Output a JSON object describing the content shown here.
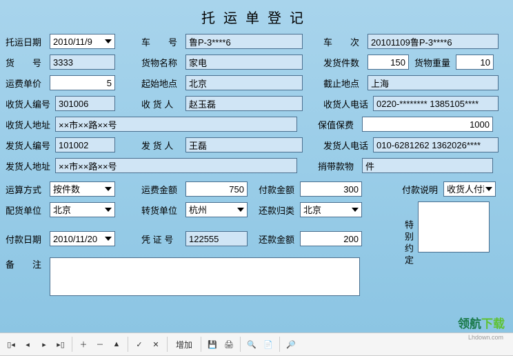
{
  "title": "托运单登记",
  "row1": {
    "date_label": "托运日期",
    "date_value": "2010/11/9",
    "plate_label": "车　　号",
    "plate_value": "鲁P-3****6",
    "trip_label": "车　　次",
    "trip_value": "20101109鲁P-3****6"
  },
  "row2": {
    "goods_no_label": "货　　号",
    "goods_no_value": "3333",
    "goods_name_label": "货物名称",
    "goods_name_value": "家电",
    "send_qty_label": "发货件数",
    "send_qty_value": "150",
    "weight_label": "货物重量",
    "weight_value": "10"
  },
  "row3": {
    "unit_price_label": "运费单价",
    "unit_price_value": "5",
    "origin_label": "起始地点",
    "origin_value": "北京",
    "dest_label": "截止地点",
    "dest_value": "上海"
  },
  "row4": {
    "recv_no_label": "收货人编号",
    "recv_no_value": "301006",
    "recv_name_label": "收 货 人",
    "recv_name_value": "赵玉磊",
    "recv_phone_label": "收货人电话",
    "recv_phone_value": "0220-******** 1385105****"
  },
  "row5": {
    "recv_addr_label": "收货人地址",
    "recv_addr_value": "××市××路××号",
    "insurance_label": "保值保费",
    "insurance_value": "1000"
  },
  "row6": {
    "send_no_label": "发货人编号",
    "send_no_value": "101002",
    "send_name_label": "发 货 人",
    "send_name_value": "王磊",
    "send_phone_label": "发货人电话",
    "send_phone_value": "010-6281262 1362026****"
  },
  "row7": {
    "send_addr_label": "发货人地址",
    "send_addr_value": "××市××路××号",
    "carry_label": "捎带款物",
    "carry_value": "件"
  },
  "row8": {
    "calc_label": "运算方式",
    "calc_value": "按件数",
    "freight_label": "运费金额",
    "freight_value": "750",
    "pay_amt_label": "付款金额",
    "pay_amt_value": "300",
    "pay_desc_label": "付款说明",
    "pay_desc_value": "收货人付款"
  },
  "row9": {
    "dist_label": "配货单位",
    "dist_value": "北京",
    "trans_label": "转货单位",
    "trans_value": "杭州",
    "repay_cat_label": "还款归类",
    "repay_cat_value": "北京"
  },
  "row10": {
    "pay_date_label": "付款日期",
    "pay_date_value": "2010/11/20",
    "voucher_label": "凭 证 号",
    "voucher_value": "122555",
    "repay_amt_label": "还款金额",
    "repay_amt_value": "200"
  },
  "row11": {
    "remark_label": "备　　注",
    "remark_value": "",
    "special_label": "特别约定",
    "special_value": ""
  },
  "toolbar": {
    "add": "增加"
  },
  "watermark": {
    "brand1": "领航",
    "brand2": "下载",
    "url": "Lhdown.com"
  }
}
